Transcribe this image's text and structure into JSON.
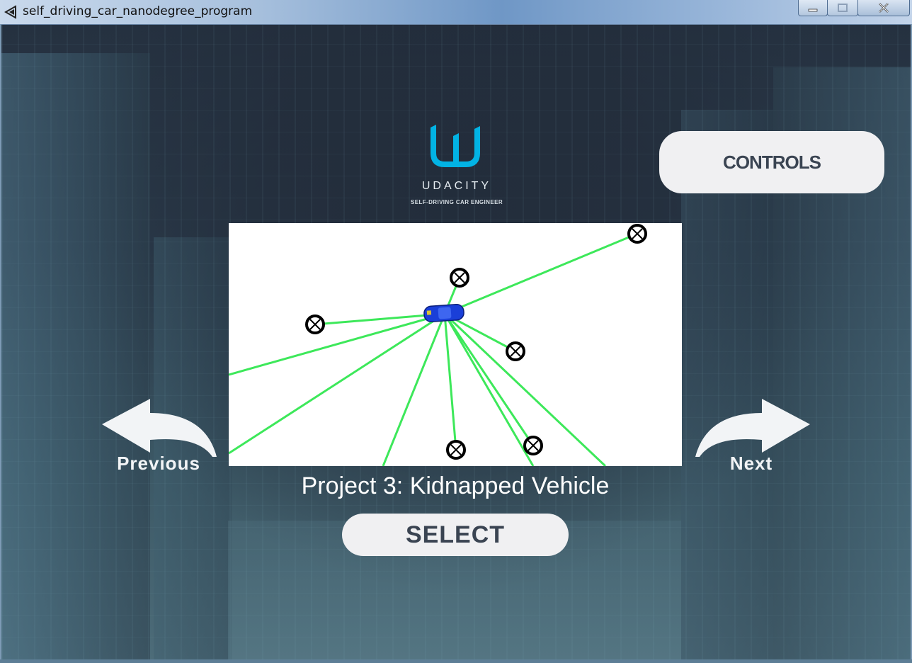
{
  "window": {
    "title": "self_driving_car_nanodegree_program"
  },
  "logo": {
    "wordmark": "UDACITY",
    "subtitle": "SELF-DRIVING CAR ENGINEER",
    "accent_color": "#02b3e4"
  },
  "controls_button": {
    "label": "CONTROLS"
  },
  "navigation": {
    "previous_label": "Previous",
    "next_label": "Next"
  },
  "project": {
    "title": "Project 3: Kidnapped Vehicle"
  },
  "select_button": {
    "label": "SELECT"
  },
  "colors": {
    "background": "#2a3645",
    "button_bg": "#f0f0f2",
    "button_text": "#3a4452",
    "ray_color": "#3de85a",
    "vehicle_color": "#1a3fd8"
  }
}
